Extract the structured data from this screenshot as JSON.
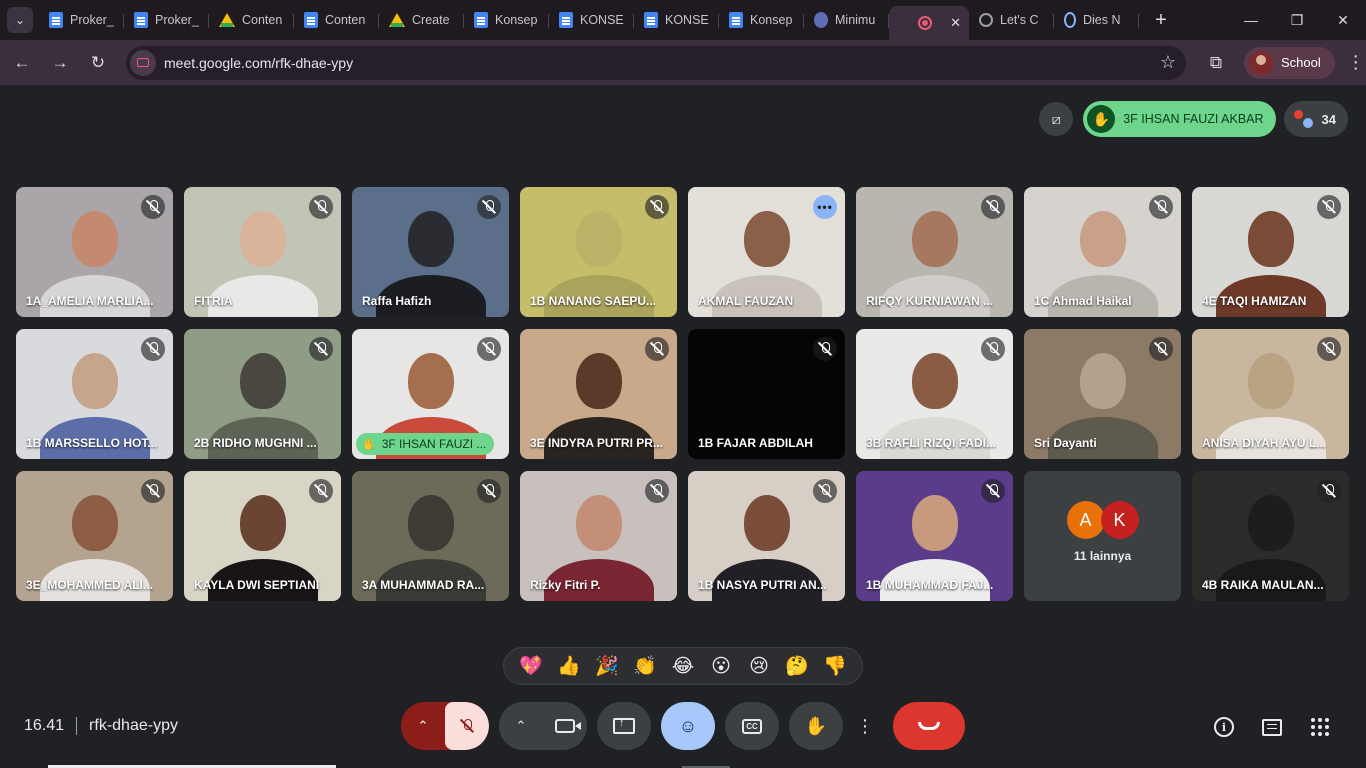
{
  "browser": {
    "tabs": [
      {
        "label": "Proker_",
        "icon": "doc"
      },
      {
        "label": "Proker_",
        "icon": "doc"
      },
      {
        "label": "Conten",
        "icon": "drive"
      },
      {
        "label": "Conten",
        "icon": "doc"
      },
      {
        "label": "Create",
        "icon": "drive"
      },
      {
        "label": "Konsep",
        "icon": "doc"
      },
      {
        "label": "KONSE",
        "icon": "doc"
      },
      {
        "label": "KONSE",
        "icon": "doc"
      },
      {
        "label": "Konsep",
        "icon": "doc"
      },
      {
        "label": "Minimu",
        "icon": "tool"
      },
      {
        "label": "",
        "icon": "meet",
        "active": true
      },
      {
        "label": "Let's C",
        "icon": "globe"
      },
      {
        "label": "Dies N",
        "icon": "ring"
      }
    ],
    "url": "meet.google.com/rfk-dhae-ypy",
    "profile_label": "School"
  },
  "meet": {
    "raised_hand_name": "3F IHSAN FAUZI AKBAR",
    "participant_count": "34",
    "meeting_time": "16.41",
    "meeting_code": "rfk-dhae-ypy",
    "reactions": [
      "💖",
      "👍",
      "🎉",
      "👏",
      "😂",
      "😮",
      "😢",
      "🤔",
      "👎"
    ],
    "participants": [
      {
        "name": "1A_AMELIA MARLIA...",
        "bg": "#a9a5a8",
        "skin": "#c48a6f",
        "cloth": "#d7d5d8",
        "muted": true
      },
      {
        "name": "FITRIA",
        "bg": "#c2c4b6",
        "skin": "#d9b39a",
        "cloth": "#e8e8e6",
        "muted": true
      },
      {
        "name": "Raffa Hafizh",
        "bg": "#5b6e8a",
        "skin": "#2a2c32",
        "cloth": "#1b1d22",
        "muted": true
      },
      {
        "name": "1B NANANG SAEPU...",
        "bg": "#c5bd6a",
        "skin": "#bdb368",
        "cloth": "#aaa35b",
        "muted": true
      },
      {
        "name": "AKMAL FAUZAN",
        "bg": "#e3dfd9",
        "skin": "#8a6048",
        "cloth": "#c9c2bb",
        "muted": false,
        "speaking": true
      },
      {
        "name": "RIFQY KURNIAWAN ...",
        "bg": "#b9b6b0",
        "skin": "#a77860",
        "cloth": "#d0ccc8",
        "muted": true
      },
      {
        "name": "1C Ahmad Haikal",
        "bg": "#d6d3cf",
        "skin": "#c9a18a",
        "cloth": "#b9b4ad",
        "muted": true
      },
      {
        "name": "4E TAQI HAMIZAN",
        "bg": "#d8d8d5",
        "skin": "#7a4b36",
        "cloth": "#6d3a2a",
        "muted": true
      },
      {
        "name": "1B MARSSELLO HOT...",
        "bg": "#d9dadd",
        "skin": "#c7a58c",
        "cloth": "#5b6ea8",
        "muted": true
      },
      {
        "name": "2B RIDHO MUGHNI ...",
        "bg": "#8f9c86",
        "skin": "#4a4740",
        "cloth": "#5d6455",
        "muted": true
      },
      {
        "name": "",
        "bg": "#e8e6e4",
        "skin": "#a56f4f",
        "cloth": "#c94b3c",
        "muted": true,
        "hand_pill": "3F IHSAN FAUZI ..."
      },
      {
        "name": "3E INDYRA PUTRI PR...",
        "bg": "#c9a98a",
        "skin": "#5c3a2a",
        "cloth": "#2a2421",
        "muted": true
      },
      {
        "name": "1B FAJAR ABDILAH",
        "bg": "#050505",
        "skin": "#050505",
        "cloth": "#050505",
        "muted": true
      },
      {
        "name": "3B RAFLI RIZQI FADI...",
        "bg": "#e9e9e7",
        "skin": "#8a5c44",
        "cloth": "#d9d9d6",
        "muted": true
      },
      {
        "name": "Sri Dayanti",
        "bg": "#8c7a66",
        "skin": "#b4a08d",
        "cloth": "#5e5a4e",
        "muted": true
      },
      {
        "name": "ANISA DIYAH AYU L...",
        "bg": "#c8b79e",
        "skin": "#b9a383",
        "cloth": "#e7e3dc",
        "muted": true
      },
      {
        "name": "3E_MOHAMMED ALI...",
        "bg": "#b3a38f",
        "skin": "#8d5e45",
        "cloth": "#e4e1de",
        "muted": true
      },
      {
        "name": "KAYLA DWI SEPTIANI",
        "bg": "#d9d5c6",
        "skin": "#6b4534",
        "cloth": "#191517",
        "muted": true
      },
      {
        "name": "3A MUHAMMAD RA...",
        "bg": "#6e6a5a",
        "skin": "#3f3a33",
        "cloth": "#3a3a36",
        "muted": true
      },
      {
        "name": "Rizky Fitri P.",
        "bg": "#c7c0bd",
        "skin": "#c48f78",
        "cloth": "#7a2533",
        "muted": true
      },
      {
        "name": "1B NASYA PUTRI AN...",
        "bg": "#d7cfc5",
        "skin": "#7a4c3a",
        "cloth": "#222026",
        "muted": true
      },
      {
        "name": "1B MUHAMMAD FAJ...",
        "bg": "#5a3c8a",
        "skin": "#c79a7e",
        "cloth": "#ececec",
        "muted": true
      },
      {
        "others": true,
        "label": "11 lainnya",
        "avatars": [
          {
            "letter": "A",
            "color": "#e8710a"
          },
          {
            "letter": "K",
            "color": "#c5221f"
          }
        ]
      },
      {
        "name": "4B RAIKA MAULAN...",
        "bg": "#2b2b2a",
        "skin": "#1e1d1c",
        "cloth": "#1a1918",
        "muted": true
      }
    ]
  }
}
